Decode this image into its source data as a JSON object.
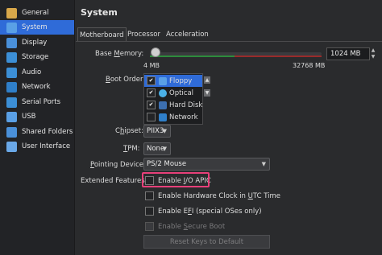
{
  "sidebar": {
    "items": [
      {
        "label": "General",
        "icon": "general-icon",
        "color": "#d9a84a"
      },
      {
        "label": "System",
        "icon": "system-icon",
        "color": "#5aa0e6",
        "active": true
      },
      {
        "label": "Display",
        "icon": "display-icon",
        "color": "#4a90d9"
      },
      {
        "label": "Storage",
        "icon": "storage-icon",
        "color": "#3c8fd6"
      },
      {
        "label": "Audio",
        "icon": "audio-icon",
        "color": "#3c8fd6"
      },
      {
        "label": "Network",
        "icon": "network-icon",
        "color": "#2f7fc9"
      },
      {
        "label": "Serial Ports",
        "icon": "serial-ports-icon",
        "color": "#3c8fd6"
      },
      {
        "label": "USB",
        "icon": "usb-icon",
        "color": "#5aa0e6"
      },
      {
        "label": "Shared Folders",
        "icon": "shared-folders-icon",
        "color": "#4a90d9"
      },
      {
        "label": "User Interface",
        "icon": "user-interface-icon",
        "color": "#6aa8e8"
      }
    ]
  },
  "main": {
    "title": "System",
    "tabs": [
      {
        "label": "Motherboard",
        "active": true
      },
      {
        "label": "Processor"
      },
      {
        "label": "Acceleration"
      }
    ],
    "base_memory": {
      "label": "Base Memory:",
      "value": "1024 MB",
      "min_label": "4 MB",
      "max_label": "32768 MB",
      "level": 0.031
    },
    "boot_order": {
      "label": "Boot Order:",
      "items": [
        {
          "label": "Floppy",
          "checked": true,
          "selected": true,
          "icon": "floppy-icon"
        },
        {
          "label": "Optical",
          "checked": true,
          "icon": "optical-icon"
        },
        {
          "label": "Hard Disk",
          "checked": true,
          "icon": "hard-disk-icon"
        },
        {
          "label": "Network",
          "checked": false,
          "icon": "network-boot-icon"
        }
      ]
    },
    "chipset": {
      "label": "Chipset:",
      "value": "PIIX3"
    },
    "tpm": {
      "label": "TPM:",
      "value": "None"
    },
    "pointing_device": {
      "label": "Pointing Device:",
      "value": "PS/2 Mouse"
    },
    "extended_features": {
      "label": "Extended Features:",
      "options": [
        {
          "label": "Enable I/O APIC",
          "checked": false
        },
        {
          "label": "Enable Hardware Clock in UTC Time",
          "checked": false
        },
        {
          "label": "Enable EFI (special OSes only)",
          "checked": false
        },
        {
          "label": "Enable Secure Boot",
          "checked": false,
          "disabled": true
        }
      ]
    },
    "reset_keys_label": "Reset Keys to Default",
    "highlight_color": "#e8407a",
    "accent_color": "#2f6bd8"
  }
}
